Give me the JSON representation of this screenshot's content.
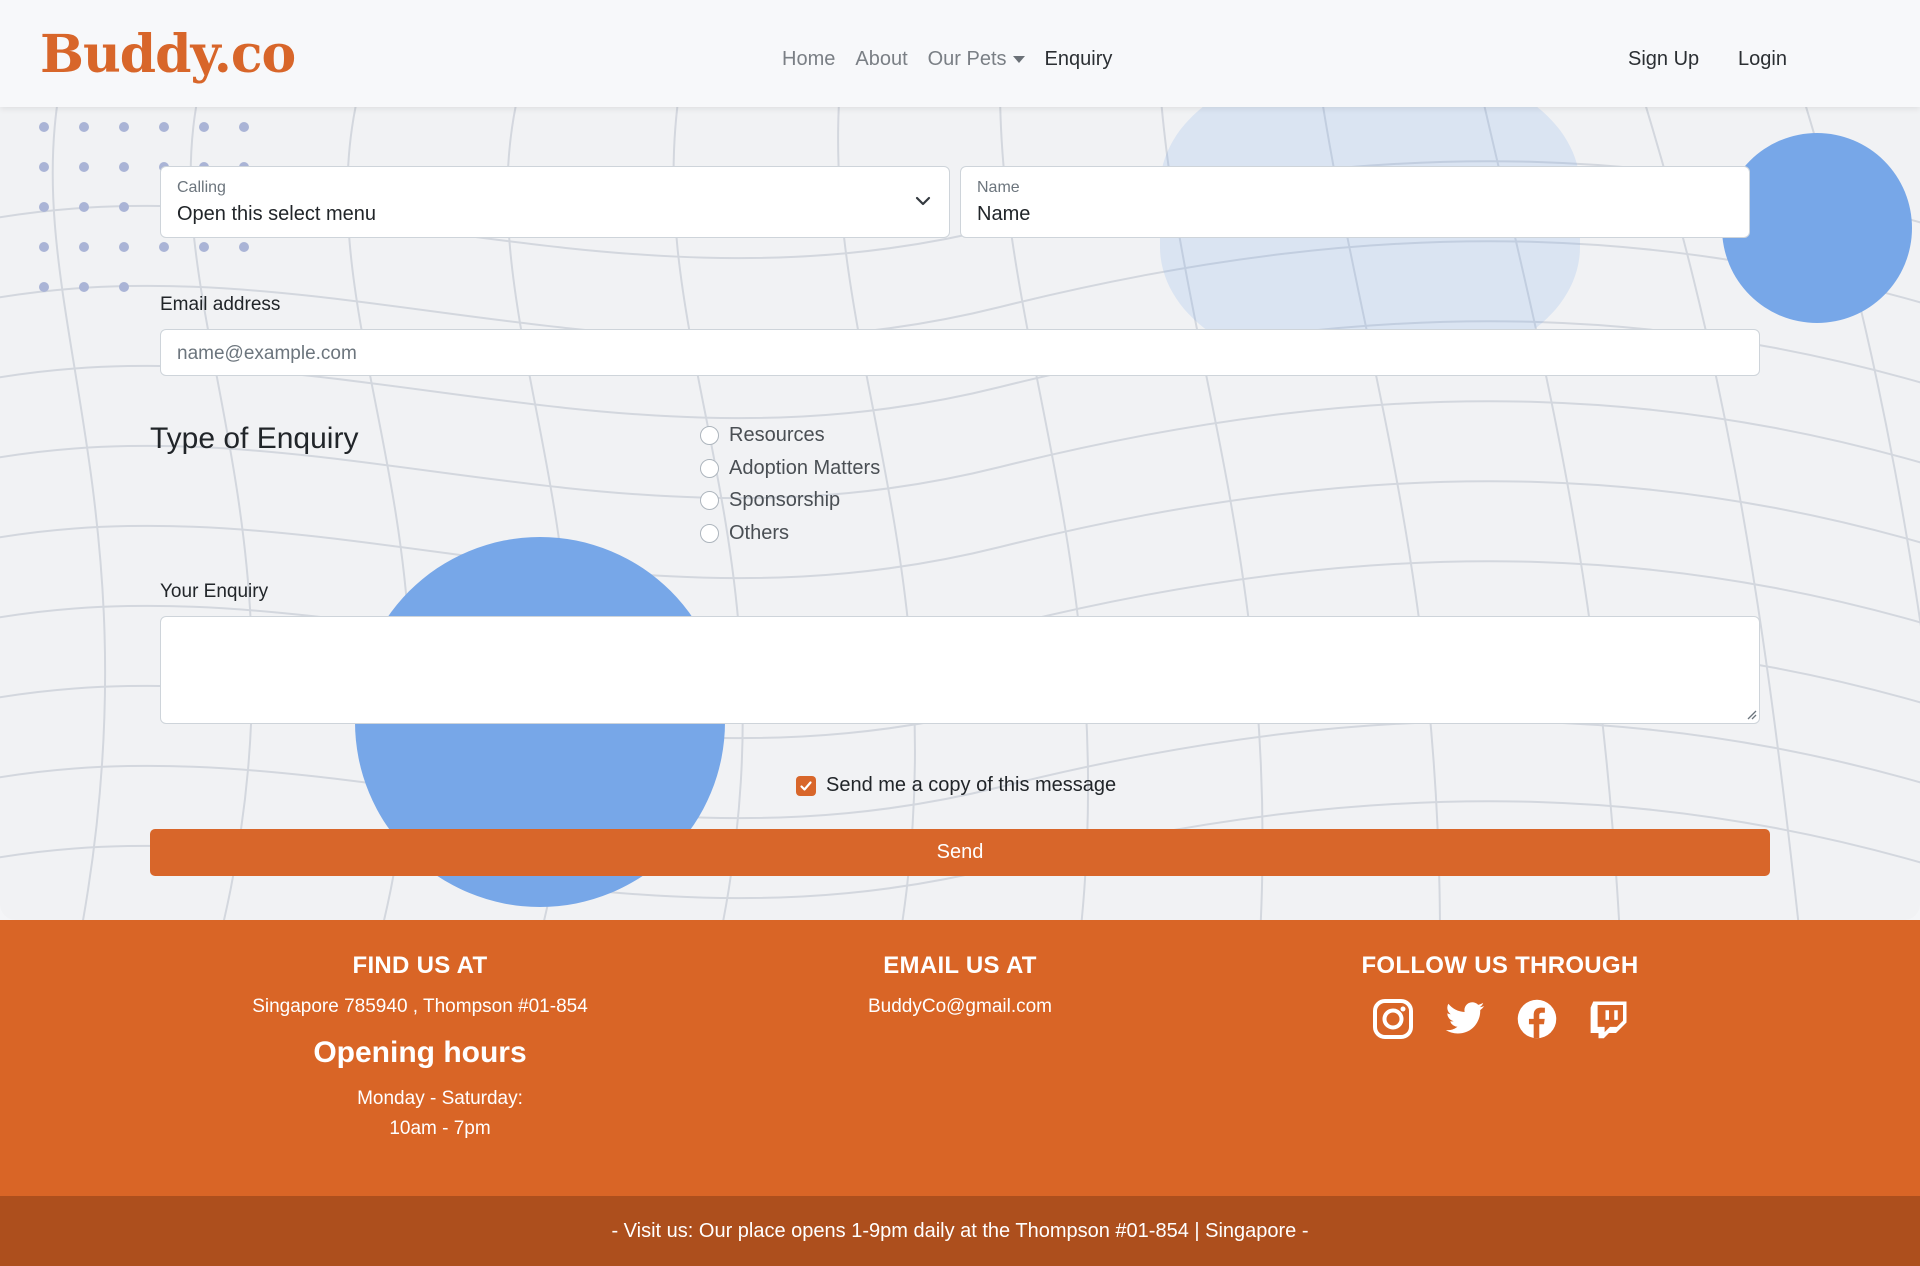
{
  "nav": {
    "brand": "Buddy.co",
    "links": [
      "Home",
      "About",
      "Our Pets",
      "Enquiry"
    ],
    "active": "Enquiry",
    "sign_up": "Sign Up",
    "login": "Login"
  },
  "form": {
    "calling": {
      "label": "Calling",
      "value": "Open this select menu"
    },
    "name": {
      "label": "Name",
      "value": "Name"
    },
    "email": {
      "label": "Email address",
      "placeholder": "name@example.com"
    },
    "enquiry_type": {
      "title": "Type of Enquiry",
      "options": [
        "Resources",
        "Adoption Matters",
        "Sponsorship",
        "Others"
      ]
    },
    "your_enquiry": {
      "label": "Your Enquiry",
      "value": ""
    },
    "copy_checkbox": {
      "label": "Send me a copy of this message",
      "checked": true
    },
    "send_label": "Send"
  },
  "footer": {
    "find_us": {
      "heading": "FIND US AT",
      "address": "Singapore 785940 , Thompson #01-854"
    },
    "opening": {
      "heading": "Opening hours",
      "days": "Monday - Saturday:",
      "hours": "10am - 7pm"
    },
    "email_us": {
      "heading": "EMAIL US AT",
      "email": "BuddyCo@gmail.com"
    },
    "follow": {
      "heading": "FOLLOW US THROUGH",
      "icons": [
        "instagram-icon",
        "twitter-icon",
        "facebook-icon",
        "twitch-icon"
      ]
    },
    "bottom_text": "- Visit us: Our place opens 1-9pm daily at the Thompson #01-854 | Singapore -"
  },
  "colors": {
    "brand": "#d8662a",
    "footer": "#d96526",
    "footer_bottom": "#ad4f1d",
    "blob": "#77a7e8"
  }
}
